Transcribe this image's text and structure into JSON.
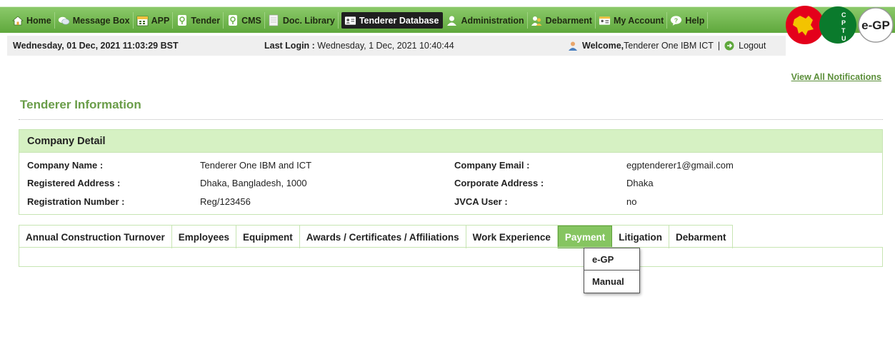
{
  "nav": {
    "items": [
      {
        "label": "Home",
        "icon": "home-icon"
      },
      {
        "label": "Message Box",
        "icon": "message-icon"
      },
      {
        "label": "APP",
        "icon": "calendar-icon"
      },
      {
        "label": "Tender",
        "icon": "tender-icon"
      },
      {
        "label": "CMS",
        "icon": "cms-icon"
      },
      {
        "label": "Doc. Library",
        "icon": "document-icon"
      },
      {
        "label": "Tenderer Database",
        "icon": "id-card-icon"
      },
      {
        "label": "Administration",
        "icon": "user-icon"
      },
      {
        "label": "Debarment",
        "icon": "users-icon"
      },
      {
        "label": "My Account",
        "icon": "id-card-icon"
      },
      {
        "label": "Help",
        "icon": "help-icon"
      }
    ],
    "active": "Tenderer Database"
  },
  "infobar": {
    "date": "Wednesday, 01 Dec, 2021 11:03:29 BST",
    "last_login_label": "Last Login :",
    "last_login_value": " Wednesday, 1 Dec, 2021 10:40:44",
    "welcome_label": "Welcome,",
    "welcome_value": " Tenderer One IBM ICT",
    "separator": "|",
    "logout_label": "Logout"
  },
  "logo": {
    "letters": [
      "C",
      "P",
      "T",
      "U"
    ],
    "text": "e-GP"
  },
  "notifications_link": "View All Notifications",
  "section_title": "Tenderer Information",
  "company": {
    "heading": "Company Detail",
    "rows": [
      {
        "left_label": "Company Name :",
        "left_value": "Tenderer One IBM and ICT",
        "right_label": "Company Email :",
        "right_value": "egptenderer1@gmail.com"
      },
      {
        "left_label": "Registered Address :",
        "left_value": "Dhaka, Bangladesh, 1000",
        "right_label": "Corporate Address :",
        "right_value": "Dhaka"
      },
      {
        "left_label": "Registration Number :",
        "left_value": "Reg/123456",
        "right_label": "JVCA User :",
        "right_value": "no"
      }
    ]
  },
  "tabs": {
    "items": [
      "Annual Construction Turnover",
      "Employees",
      "Equipment",
      "Awards / Certificates / Affiliations",
      "Work Experience",
      "Payment",
      "Litigation",
      "Debarment"
    ],
    "active": "Payment"
  },
  "payment_dropdown": {
    "items": [
      "e-GP",
      "Manual"
    ]
  },
  "colors": {
    "nav_green": "#6bb247",
    "title_green": "#6a9d49",
    "panel_header": "#d6f1c3",
    "active_tab": "#86c561"
  }
}
